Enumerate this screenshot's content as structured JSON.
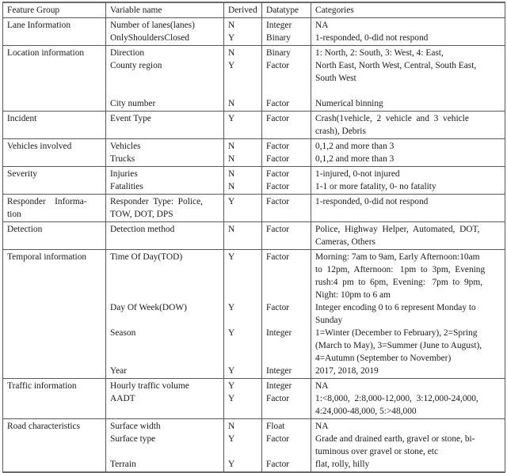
{
  "table": {
    "headers": [
      "Feature Group",
      "Variable name",
      "Derived",
      "Datatype",
      "Categories"
    ],
    "rows": [
      {
        "group": "Lane Information",
        "variables": [
          "Number of lanes(lanes)",
          "OnlyShouldersClosed"
        ],
        "derived": [
          "N",
          "Y"
        ],
        "datatype": [
          "Integer",
          "Binary"
        ],
        "categories": [
          "NA",
          "1-responded, 0-did not respond"
        ]
      },
      {
        "group": "Location information",
        "variables": [
          "Direction",
          "County region",
          "",
          "",
          "City number"
        ],
        "derived": [
          "N",
          "Y",
          "",
          "",
          "N"
        ],
        "datatype": [
          "Binary",
          "Factor",
          "",
          "",
          "Factor"
        ],
        "categories": [
          "1: North, 2: South, 3: West, 4: East,",
          "North East, North West, Central, South East,",
          "South West",
          "",
          "Numerical binning"
        ]
      },
      {
        "group": "Incident",
        "variables": [
          "Event Type"
        ],
        "derived": [
          "Y"
        ],
        "datatype": [
          "Factor"
        ],
        "categories": [
          "Crash(1vehicle,  2  vehicle  and  3  vehicle",
          "crash), Debris"
        ]
      },
      {
        "group": "Vehicles involved",
        "variables": [
          "Vehicles",
          "Trucks"
        ],
        "derived": [
          "N",
          "N"
        ],
        "datatype": [
          "Factor",
          "Factor"
        ],
        "categories": [
          "0,1,2 and more than 3",
          "0,1,2 and more than 3"
        ]
      },
      {
        "group": "Severity",
        "variables": [
          "Injuries",
          "Fatalities"
        ],
        "derived": [
          "N",
          "N"
        ],
        "datatype": [
          "Factor",
          "Factor"
        ],
        "categories": [
          "1-injured, 0-not injured",
          "1-1 or more fatality, 0- no fatality"
        ]
      },
      {
        "group": "Responder    Informa-\ntion",
        "variables": [
          "Responder  Type:  Police,",
          "TOW, DOT, DPS"
        ],
        "derived": [
          "Y",
          ""
        ],
        "datatype": [
          "Factor",
          ""
        ],
        "categories": [
          "1-responded, 0-did not respond",
          ""
        ]
      },
      {
        "group": "Detection",
        "variables": [
          "Detection method"
        ],
        "derived": [
          "N"
        ],
        "datatype": [
          "Factor"
        ],
        "categories": [
          "Police,  Highway  Helper,  Automated,  DOT,",
          "Cameras, Others"
        ]
      },
      {
        "group": "Temporal information",
        "variables": [
          "Time Of Day(TOD)",
          "",
          "",
          "",
          "Day Of Week(DOW)",
          "",
          "Season",
          "",
          "",
          "Year"
        ],
        "derived": [
          "Y",
          "",
          "",
          "",
          "Y",
          "",
          "Y",
          "",
          "",
          "Y"
        ],
        "datatype": [
          "Factor",
          "",
          "",
          "",
          "Factor",
          "",
          "Integer",
          "",
          "",
          "Integer"
        ],
        "categories": [
          "Morning: 7am to 9am, Early Afternoon:10am",
          "to  12pm,  Afternoon:   1pm  to  3pm,  Evening",
          "rush:4  pm  to  6pm,  Evening:   7pm  to  9pm,",
          "Night: 10pm to 6 am",
          "Integer encoding 0 to 6 represent Monday to",
          "Sunday",
          "1=Winter (December to February), 2=Spring",
          "(March to May), 3=Summer (June to August),",
          "4=Autumn (September to November)",
          "2017, 2018, 2019"
        ]
      },
      {
        "group": "Traffic information",
        "variables": [
          "Hourly traffic volume",
          "AADT",
          ""
        ],
        "derived": [
          "Y",
          "Y",
          ""
        ],
        "datatype": [
          "Integer",
          "Factor",
          ""
        ],
        "categories": [
          "NA",
          "1:<8,000,  2:8,000-12,000,  3:12,000-24,000,",
          "4:24,000-48,000, 5:>48,000"
        ]
      },
      {
        "group": "Road characteristics",
        "variables": [
          "Surface width",
          "Surface type",
          "",
          "Terrain"
        ],
        "derived": [
          "N",
          "Y",
          "",
          "Y"
        ],
        "datatype": [
          "Float",
          "Factor",
          "",
          "Factor"
        ],
        "categories": [
          "NA",
          "Grade and drained earth, gravel or stone, bi-",
          "tuminous over gravel or stone, etc",
          "flat, rolly, hilly"
        ]
      }
    ]
  }
}
